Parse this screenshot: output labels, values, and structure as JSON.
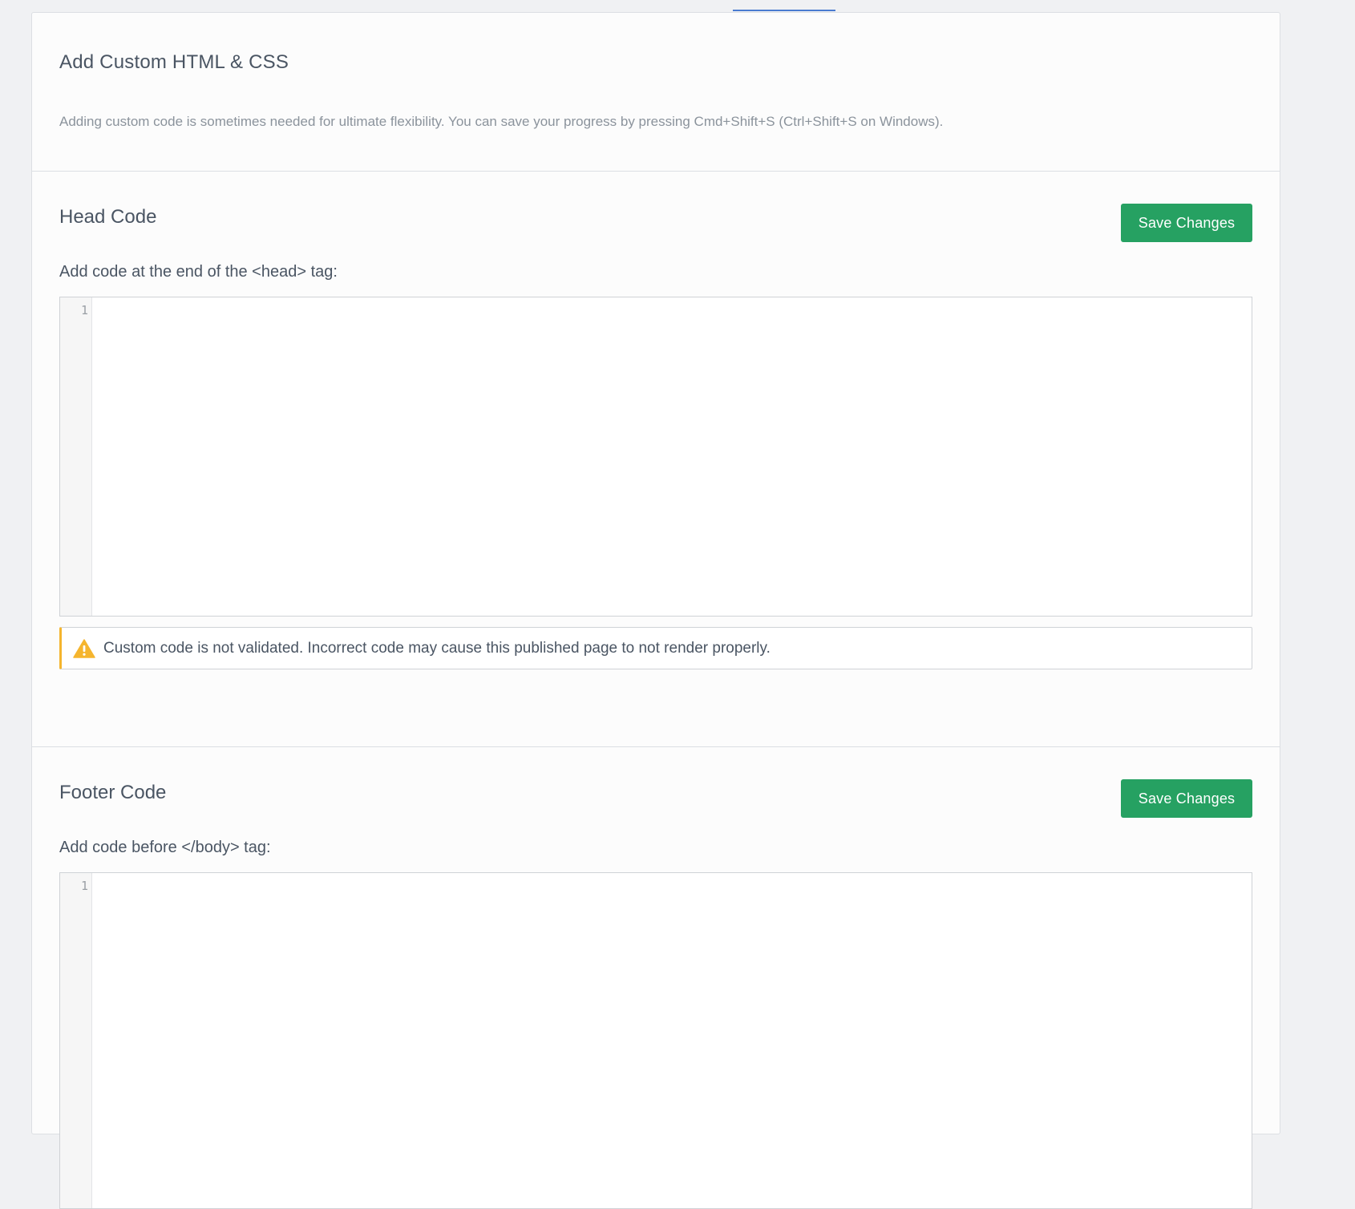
{
  "intro": {
    "title": "Add Custom HTML & CSS",
    "description": "Adding custom code is sometimes needed for ultimate flexibility. You can save your progress by pressing Cmd+Shift+S (Ctrl+Shift+S on Windows)."
  },
  "head_section": {
    "title": "Head Code",
    "save_label": "Save Changes",
    "field_label": "Add code at the end of the <head> tag:",
    "line_number": "1",
    "code_value": "",
    "warning_text": "Custom code is not validated. Incorrect code may cause this published page to not render properly."
  },
  "footer_section": {
    "title": "Footer Code",
    "save_label": "Save Changes",
    "field_label": "Add code before </body> tag:",
    "line_number": "1",
    "code_value": ""
  },
  "colors": {
    "accent_green": "#26a162",
    "warning_yellow": "#f5b52e",
    "tab_blue": "#4a7bd0"
  },
  "icons": {
    "warning": "warning-triangle-icon"
  }
}
